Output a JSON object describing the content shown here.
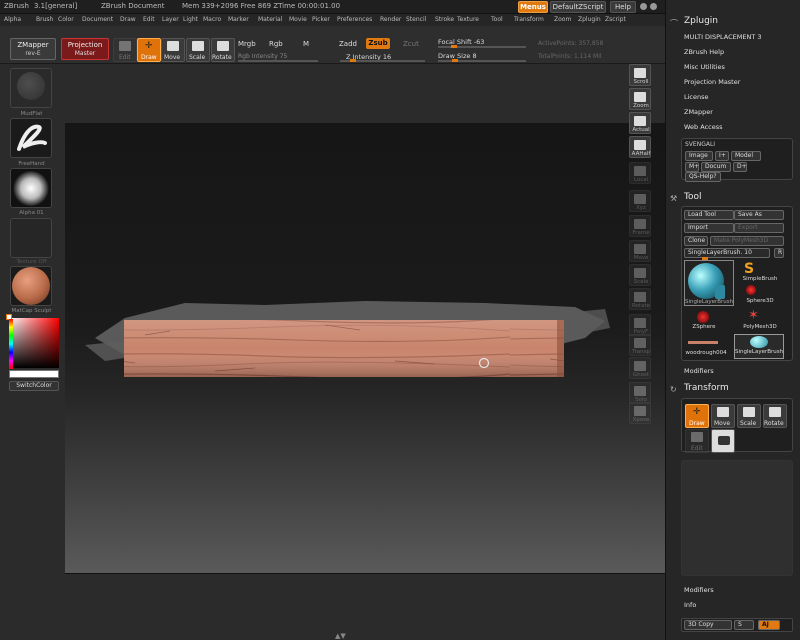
{
  "titlebar": {
    "app": "ZBrush",
    "version": "3.1[general]",
    "document": "ZBrush Document",
    "mem": "Mem 339+2096 Free 869 ZTime 00:00:01.00",
    "menus_btn": "Menus",
    "script_btn": "DefaultZScript",
    "help_btn": "Help"
  },
  "menubar": {
    "items": [
      "Alpha",
      "Brush",
      "Color",
      "Document",
      "Draw",
      "Edit",
      "Layer",
      "Light",
      "Macro",
      "Marker",
      "Material",
      "Movie",
      "Picker",
      "Preferences",
      "Render",
      "Stencil",
      "Stroke",
      "Texture",
      "Tool",
      "Transform",
      "Zoom",
      "Zplugin",
      "Zscript"
    ]
  },
  "toolbar": {
    "zmapper": "ZMapper",
    "zmapper_sub": "rev-E",
    "projection": "Projection",
    "projection_sub": "Master",
    "edit": "Edit",
    "draw": "Draw",
    "move": "Move",
    "scale": "Scale",
    "rotate": "Rotate",
    "mrgb": "Mrgb",
    "rgb": "Rgb",
    "m": "M",
    "rgb_intensity": "Rgb Intensity 75",
    "zadd": "Zadd",
    "zsub": "Zsub",
    "zcut": "Zcut",
    "z_intensity": "Z Intensity 16",
    "focal_shift": "Focal Shift -63",
    "draw_size": "Draw Size 8",
    "active_points": "ActivePoints: 357,858",
    "total_points": "TotalPoints: 1.114 Mil"
  },
  "leftshelf": {
    "brush_lbl": "MudFlat",
    "stroke_lbl": "FreeHand",
    "alpha_lbl": "Alpha 01",
    "texture_lbl": "Texture Off",
    "material_lbl": "MatCap Sculpt",
    "switch_color": "SwitchColor"
  },
  "rightshelf": {
    "scroll": "Scroll",
    "zoom": "Zoom",
    "actual": "Actual",
    "aahalf": "AAHalf",
    "local": "Local",
    "xyz": "Xyz",
    "frame": "Frame",
    "move": "Move",
    "scale": "Scale",
    "rotate": "Rotate",
    "polyf": "PolyF",
    "transp": "Transp",
    "ghost": "Ghost",
    "solo": "Solo",
    "xpose": "Xpose"
  },
  "panel": {
    "zplugin_title": "Zplugin",
    "zplugin_items": [
      "MULTI DISPLACEMENT 3",
      "ZBrush Help",
      "Misc Utilities",
      "Projection Master",
      "License",
      "ZMapper",
      "Web Access"
    ],
    "svengali": "SVENGALI",
    "image": "Image",
    "i_plus": "I+",
    "model": "Model",
    "m_plus": "M+",
    "docum": "Docum",
    "d_plus": "D+",
    "qs_help": "QS-Help?",
    "tool_title": "Tool",
    "load_tool": "Load Tool",
    "save_as": "Save As",
    "import": "Import",
    "export": "Export",
    "clone": "Clone",
    "make_polymesh": "Make PolyMesh3D",
    "current_tool": "SingleLayerBrush. 10",
    "r": "R",
    "tools": [
      "SingleLayerBrush",
      "SimpleBrush",
      "Sphere3D",
      "ZSphere",
      "PolyMesh3D",
      "woodrough004",
      "SingleLayerBrush"
    ],
    "modifiers": "Modifiers",
    "transform_title": "Transform",
    "t_draw": "Draw",
    "t_move": "Move",
    "t_scale": "Scale",
    "t_rotate": "Rotate",
    "t_edit": "Edit",
    "modifiers2": "Modifiers",
    "info": "Info",
    "copy3d": "3D Copy",
    "s": "S",
    "aj": "AJ"
  },
  "colors": {
    "accent": "#e07a10",
    "plank": "#c8806a"
  }
}
